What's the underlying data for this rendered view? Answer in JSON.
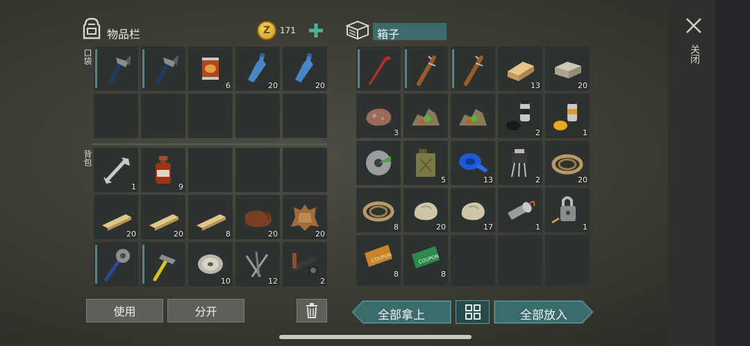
{
  "inventory": {
    "title": "物品栏",
    "coins": "171",
    "pocket_label": "口袋",
    "backpack_label": "背包",
    "pocket_items": [
      {
        "name": "hatchet",
        "count": ""
      },
      {
        "name": "hatchet",
        "count": ""
      },
      {
        "name": "canned-food",
        "count": "6"
      },
      {
        "name": "water-bottle",
        "count": "20"
      },
      {
        "name": "water-bottle",
        "count": "20"
      },
      {
        "name": "empty",
        "count": ""
      },
      {
        "name": "empty",
        "count": ""
      },
      {
        "name": "empty",
        "count": ""
      },
      {
        "name": "empty",
        "count": ""
      },
      {
        "name": "empty",
        "count": ""
      }
    ],
    "backpack_items": [
      {
        "name": "wrench",
        "count": "1"
      },
      {
        "name": "medicine-bottle",
        "count": "9"
      },
      {
        "name": "empty",
        "count": ""
      },
      {
        "name": "empty",
        "count": ""
      },
      {
        "name": "empty",
        "count": ""
      },
      {
        "name": "plank",
        "count": "20"
      },
      {
        "name": "plank",
        "count": "20"
      },
      {
        "name": "plank",
        "count": "8"
      },
      {
        "name": "leather",
        "count": "20"
      },
      {
        "name": "hide",
        "count": "20"
      },
      {
        "name": "saw-blade-club",
        "count": ""
      },
      {
        "name": "hammer",
        "count": ""
      },
      {
        "name": "wire-spool",
        "count": "10"
      },
      {
        "name": "nails",
        "count": "12"
      },
      {
        "name": "gun-parts",
        "count": "2"
      }
    ]
  },
  "box": {
    "title": "箱子",
    "items": [
      {
        "name": "crowbar",
        "count": ""
      },
      {
        "name": "nail-bat",
        "count": ""
      },
      {
        "name": "nail-bat",
        "count": ""
      },
      {
        "name": "wood-block",
        "count": "13"
      },
      {
        "name": "stone-block",
        "count": "20"
      },
      {
        "name": "ore",
        "count": "3"
      },
      {
        "name": "scrap-pile",
        "count": ""
      },
      {
        "name": "scrap-pile",
        "count": ""
      },
      {
        "name": "spray-paint-black",
        "count": "2"
      },
      {
        "name": "spray-paint-yellow",
        "count": "1"
      },
      {
        "name": "saw-blade",
        "count": ""
      },
      {
        "name": "jerrycan",
        "count": "5"
      },
      {
        "name": "duct-tape",
        "count": "13"
      },
      {
        "name": "transistor",
        "count": "2"
      },
      {
        "name": "rope",
        "count": "20"
      },
      {
        "name": "rope",
        "count": "8"
      },
      {
        "name": "stone",
        "count": "20"
      },
      {
        "name": "stone",
        "count": "17"
      },
      {
        "name": "flashlight",
        "count": "1"
      },
      {
        "name": "padlock",
        "count": "1"
      },
      {
        "name": "coupon-orange",
        "count": "8"
      },
      {
        "name": "coupon-green",
        "count": "8"
      },
      {
        "name": "empty",
        "count": ""
      },
      {
        "name": "empty",
        "count": ""
      },
      {
        "name": "empty",
        "count": ""
      }
    ]
  },
  "buttons": {
    "use": "使用",
    "split": "分开",
    "take_all": "全部拿上",
    "put_all": "全部放入",
    "close": "关闭"
  }
}
